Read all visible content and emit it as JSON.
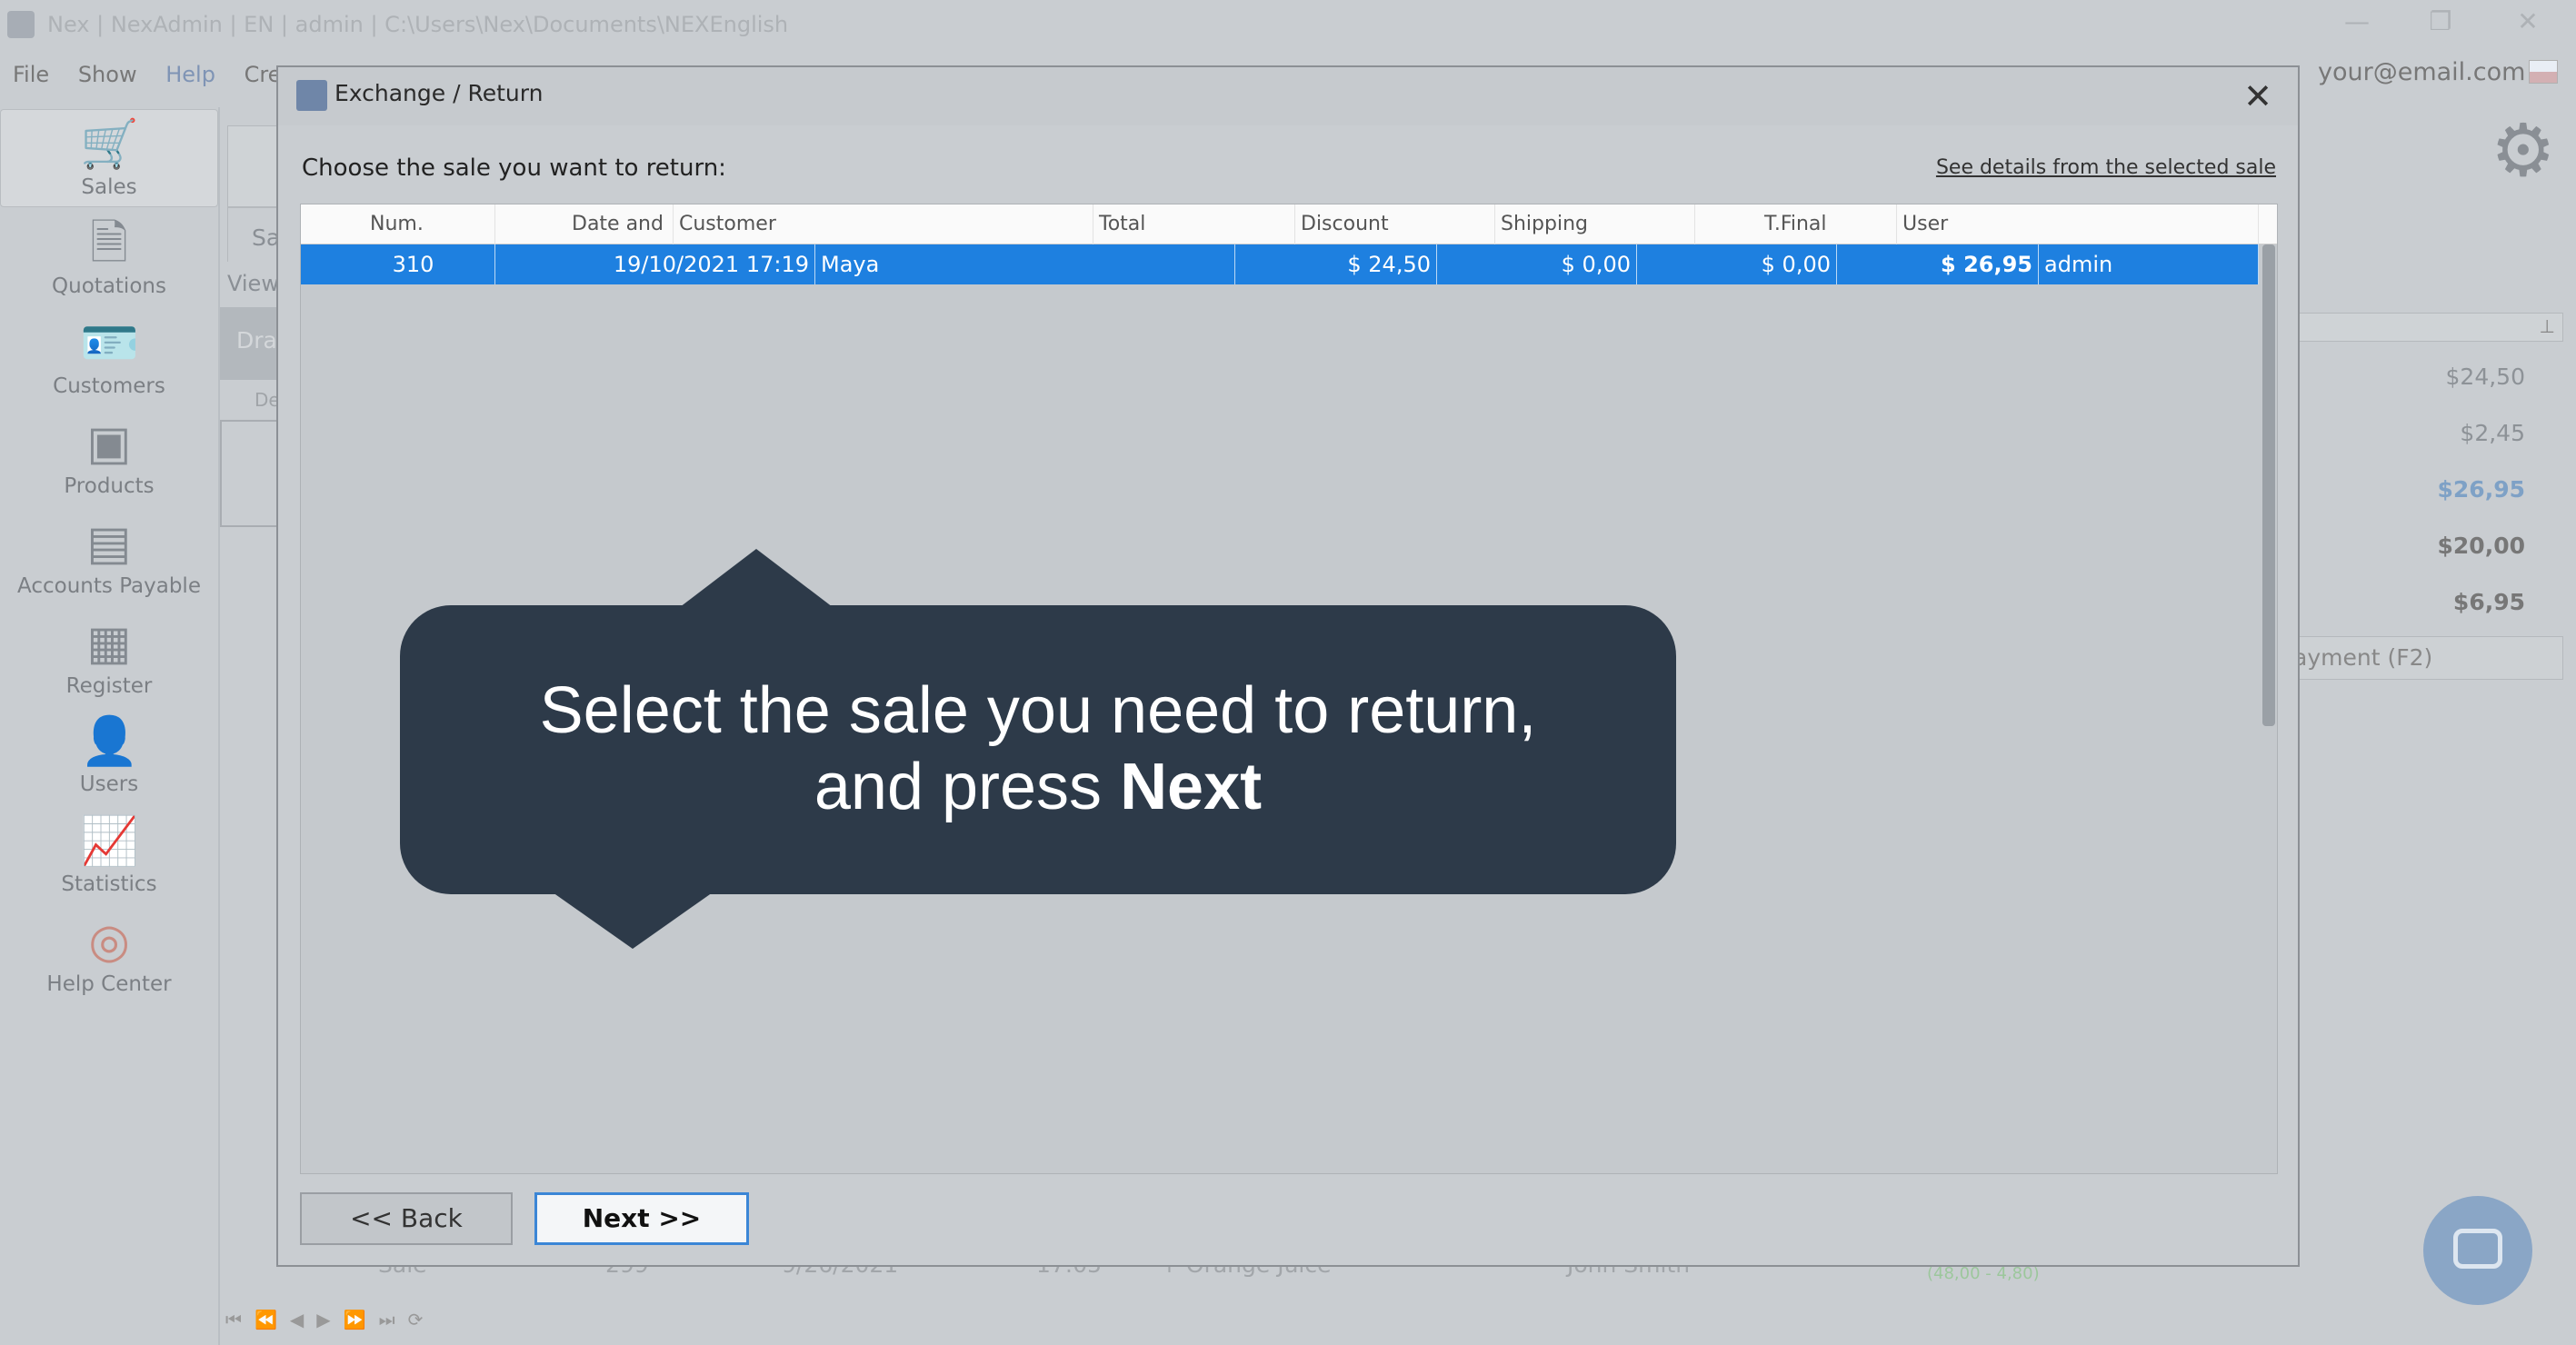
{
  "window": {
    "title": "Nex | NexAdmin | EN | admin | C:\\Users\\Nex\\Documents\\NEXEnglish",
    "minimize": "—",
    "restore": "❐",
    "close": "✕"
  },
  "menu": {
    "file": "File",
    "show": "Show",
    "help": "Help",
    "create": "Create"
  },
  "account": {
    "email": "your@email.com"
  },
  "sidebar": {
    "items": [
      {
        "label": "Sales",
        "icon": "cart-icon"
      },
      {
        "label": "Quotations",
        "icon": "document-icon"
      },
      {
        "label": "Customers",
        "icon": "id-card-icon"
      },
      {
        "label": "Products",
        "icon": "box-icon"
      },
      {
        "label": "Accounts Payable",
        "icon": "bill-icon"
      },
      {
        "label": "Register",
        "icon": "cash-register-icon"
      },
      {
        "label": "Users",
        "icon": "user-icon"
      },
      {
        "label": "Statistics",
        "icon": "chart-icon"
      },
      {
        "label": "Help Center",
        "icon": "lifebuoy-icon"
      }
    ]
  },
  "background": {
    "tab_partial": "Sa",
    "view_partial": "View",
    "draft_partial": "Dra",
    "de_partial": "De",
    "amounts": [
      "$24,50",
      "$2,45",
      "$26,95",
      "$20,00",
      "$6,95"
    ],
    "payment_button": "ayment (F2)",
    "ghost_row": {
      "type": "Sale",
      "num": "299",
      "date": "9/26/2021",
      "time": "17:05",
      "item": "+ Orange Juice",
      "customer": "John Smith",
      "note": "(48,00 - 4,80)"
    },
    "nav_controls": "⏮⏪◀▶⏩⏭⟳"
  },
  "dialog": {
    "title": "Exchange / Return",
    "prompt": "Choose the sale you want to return:",
    "details_link": "See details from the selected sale",
    "columns": [
      "Num.",
      "Date and Time",
      "Customer",
      "Total",
      "Discount",
      "Shipping",
      "T.Final",
      "User"
    ],
    "rows": [
      {
        "num": "310",
        "datetime": "19/10/2021 17:19",
        "customer": "Maya",
        "total": "$ 24,50",
        "discount": "$ 0,00",
        "shipping": "$ 0,00",
        "tfinal": "$ 26,95",
        "user": "admin"
      }
    ],
    "back_button": "<< Back",
    "next_button": "Next >>"
  },
  "callout": {
    "line1": "Select the sale you need to return,",
    "line2_prefix": "and press ",
    "line2_bold": "Next"
  },
  "colors": {
    "selected_row": "#1e80e0",
    "callout_bg": "#2d3a49",
    "next_border": "#3b86d6"
  }
}
